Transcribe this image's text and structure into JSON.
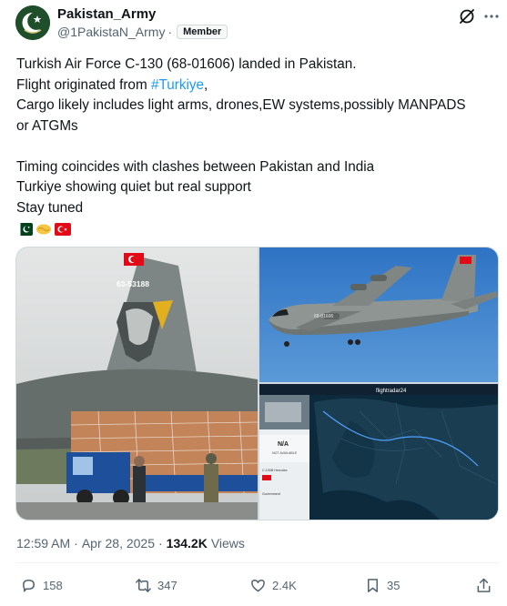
{
  "author": {
    "display_name": "Pakistan_Army",
    "handle": "@1PakistaN_Army",
    "separator": "·",
    "badge": "Member"
  },
  "tweet": {
    "line1": "Turkish Air Force C-130 (68-01606) landed in Pakistan.",
    "line2_prefix": "Flight originated from ",
    "line2_hashtag": "#Turkiye",
    "line2_suffix": ",",
    "line3": "Cargo likely includes light arms, drones,EW systems,possibly MANPADS",
    "line4": "or ATGMs",
    "line5": "Timing coincides with clashes between Pakistan and India",
    "line6": "Turkiye showing quiet but real support",
    "line7": "Stay tuned",
    "emojis": [
      "pakistan-flag",
      "handshake",
      "turkey-flag"
    ]
  },
  "media": {
    "tail_number": "63-53188",
    "top_right_tail": "68-01606",
    "fr24_brand": "flightradar24",
    "fr24_status": "N/A",
    "fr24_sub": "NOT AVAILABLE",
    "fr24_aircraft": "C-130B Hercules",
    "fr24_owner": "Government"
  },
  "meta": {
    "time": "12:59 AM",
    "date_sep": "·",
    "date": "Apr 28, 2025",
    "views_sep": "·",
    "views_count": "134.2K",
    "views_label": "Views"
  },
  "actions": {
    "replies": "158",
    "reposts": "347",
    "likes": "2.4K",
    "bookmarks": "35"
  },
  "colors": {
    "text": "#0f1419",
    "secondary": "#536471",
    "link": "#1d9bf0",
    "border": "#cfd9de"
  }
}
